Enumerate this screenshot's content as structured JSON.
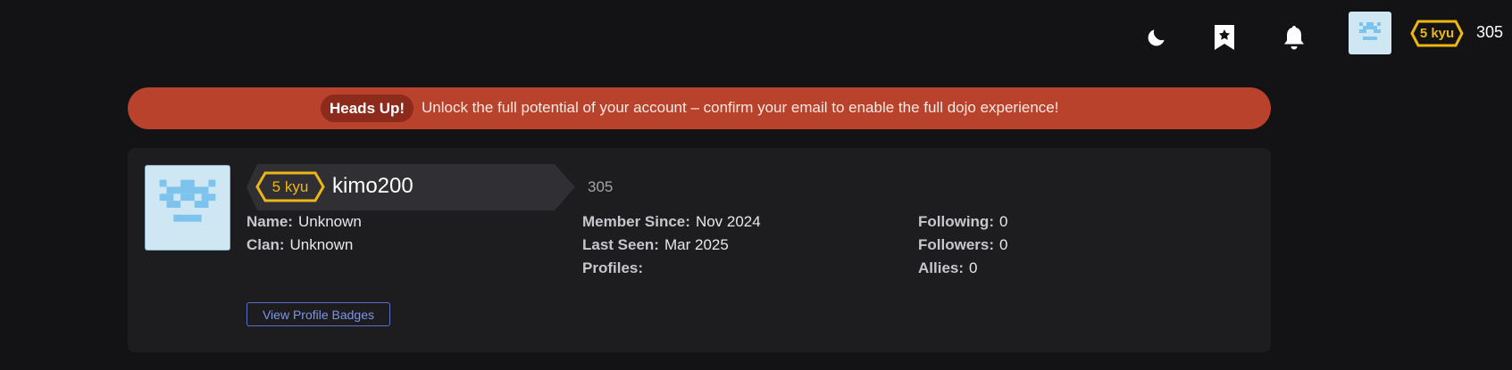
{
  "topbar": {
    "icons": [
      "moon-icon",
      "bookmark-star-icon",
      "bell-icon"
    ],
    "rank": "5 kyu",
    "honor": "305"
  },
  "alert": {
    "badge": "Heads Up!",
    "message": "Unlock the full potential of your account – confirm your email to enable the full dojo experience!"
  },
  "profile": {
    "rank": "5 kyu",
    "username": "kimo200",
    "honor": "305",
    "fields": {
      "name_label": "Name:",
      "name_value": "Unknown",
      "clan_label": "Clan:",
      "clan_value": "Unknown",
      "member_since_label": "Member Since:",
      "member_since_value": "Nov 2024",
      "last_seen_label": "Last Seen:",
      "last_seen_value": "Mar 2025",
      "profiles_label": "Profiles:",
      "following_label": "Following:",
      "following_value": "0",
      "followers_label": "Followers:",
      "followers_value": "0",
      "allies_label": "Allies:",
      "allies_value": "0"
    },
    "badges_button": "View Profile Badges"
  },
  "colors": {
    "background": "#131316",
    "card": "#1d1d20",
    "alert": "#b8422b",
    "rank_yellow": "#ecb613",
    "avatar_bg": "#cfe6f3",
    "avatar_pixel": "#7cc4ee",
    "link_blue": "#7e95e6"
  }
}
